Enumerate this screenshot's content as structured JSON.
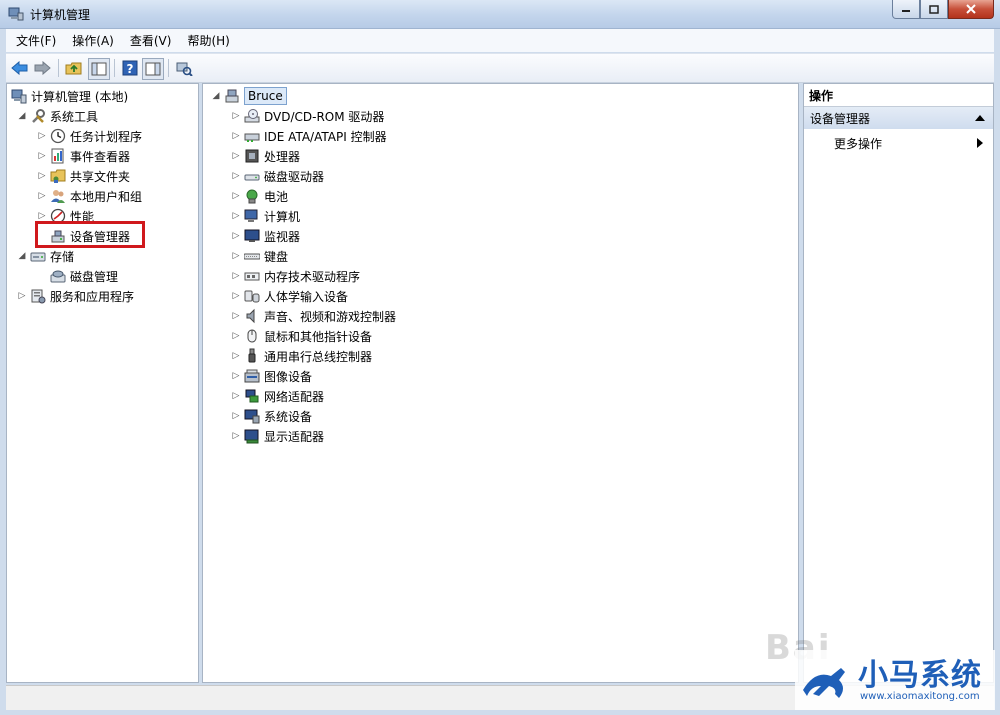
{
  "window": {
    "title": "计算机管理"
  },
  "menu": [
    "文件(F)",
    "操作(A)",
    "查看(V)",
    "帮助(H)"
  ],
  "left_tree": [
    {
      "label": "计算机管理 (本地)",
      "icon": "computer-management-icon"
    },
    {
      "label": "系统工具",
      "icon": "tools-icon"
    },
    {
      "label": "任务计划程序",
      "icon": "clock-icon"
    },
    {
      "label": "事件查看器",
      "icon": "event-viewer-icon"
    },
    {
      "label": "共享文件夹",
      "icon": "shared-folder-icon"
    },
    {
      "label": "本地用户和组",
      "icon": "users-icon"
    },
    {
      "label": "性能",
      "icon": "performance-icon"
    },
    {
      "label": "设备管理器",
      "icon": "device-manager-icon"
    },
    {
      "label": "存储",
      "icon": "storage-icon"
    },
    {
      "label": "磁盘管理",
      "icon": "disk-management-icon"
    },
    {
      "label": "服务和应用程序",
      "icon": "services-icon"
    }
  ],
  "device_tree": {
    "root": "Bruce",
    "categories": [
      "DVD/CD-ROM 驱动器",
      "IDE ATA/ATAPI 控制器",
      "处理器",
      "磁盘驱动器",
      "电池",
      "计算机",
      "监视器",
      "键盘",
      "内存技术驱动程序",
      "人体学输入设备",
      "声音、视频和游戏控制器",
      "鼠标和其他指针设备",
      "通用串行总线控制器",
      "图像设备",
      "网络适配器",
      "系统设备",
      "显示适配器"
    ]
  },
  "actions": {
    "header": "操作",
    "group": "设备管理器",
    "more": "更多操作"
  },
  "watermark": {
    "brand": "小马系统",
    "url": "www.xiaomaxitong.com",
    "baidu": "Bai"
  },
  "colors": {
    "highlight_box": "#d0181c",
    "brand": "#1f5fb8"
  }
}
